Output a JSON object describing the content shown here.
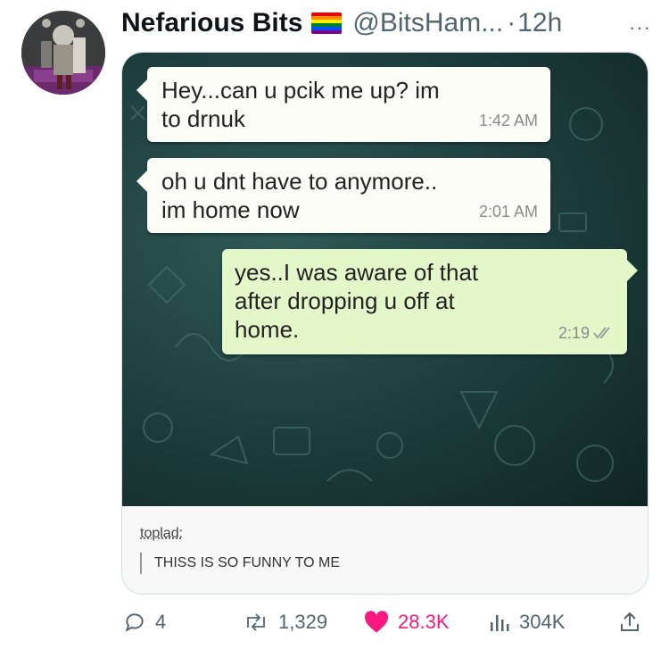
{
  "author": {
    "display_name": "Nefarious Bits",
    "handle": "@BitsHam...",
    "separator": "·",
    "time": "12h",
    "flag": "rainbow-flag"
  },
  "more_icon": "···",
  "chat": {
    "messages": [
      {
        "direction": "incoming",
        "text": "Hey...can u pcik me up? im\nto drnuk",
        "time": "1:42 AM"
      },
      {
        "direction": "incoming",
        "text": "oh u dnt have to anymore..\nim home now",
        "time": "2:01 AM"
      },
      {
        "direction": "outgoing",
        "text": "yes..I was aware of that\nafter dropping u off at\nhome.",
        "time": "2:19",
        "status_icon": "double-check-icon"
      }
    ],
    "accent": "#1f4a47"
  },
  "tumblr": {
    "username": "toplad:",
    "reply": "THISS IS SO FUNNY TO ME"
  },
  "actions": {
    "replies": "4",
    "reposts": "1,329",
    "likes": "28.3K",
    "views": "304K",
    "like_color": "#f91880"
  }
}
